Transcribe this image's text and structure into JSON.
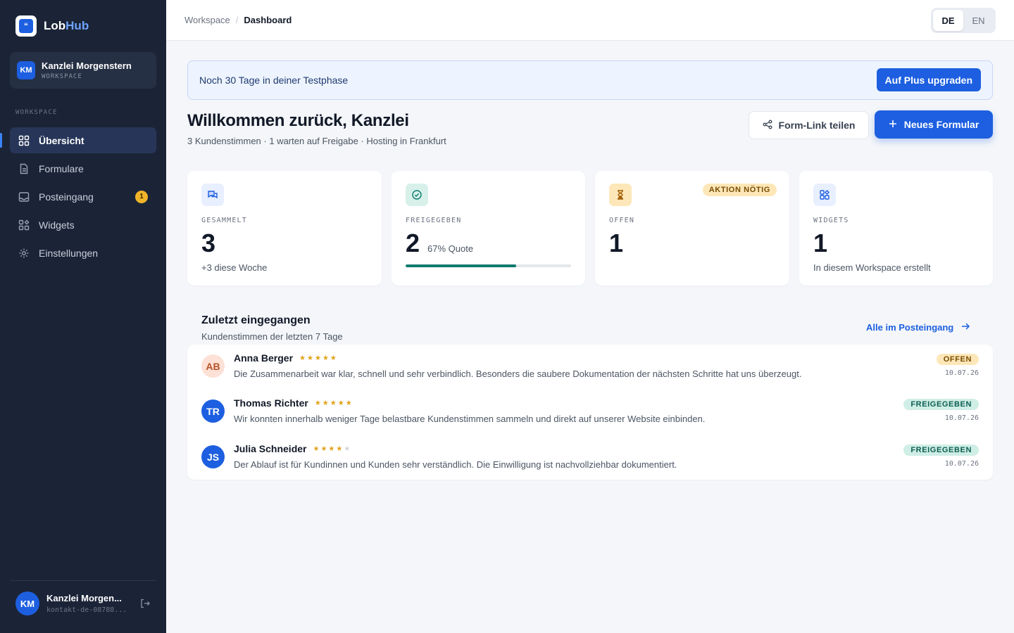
{
  "brand": {
    "name_part1": "Lob",
    "name_part2": "Hub",
    "logo_glyph": "“"
  },
  "workspace": {
    "initials": "KM",
    "name": "Kanzlei Morgenstern",
    "label": "WORKSPACE"
  },
  "sidebar": {
    "section_label": "WORKSPACE",
    "items": [
      {
        "label": "Übersicht",
        "icon": "grid-icon",
        "active": true
      },
      {
        "label": "Formulare",
        "icon": "document-icon"
      },
      {
        "label": "Posteingang",
        "icon": "inbox-icon",
        "badge": "1"
      },
      {
        "label": "Widgets",
        "icon": "widgets-icon"
      },
      {
        "label": "Einstellungen",
        "icon": "gear-icon"
      }
    ]
  },
  "user": {
    "initials": "KM",
    "name": "Kanzlei Morgen...",
    "email": "kontakt-de-08788..."
  },
  "topbar": {
    "breadcrumb": {
      "root": "Workspace",
      "separator": "/",
      "current": "Dashboard"
    },
    "languages": [
      "DE",
      "EN"
    ],
    "active_language": "DE"
  },
  "trial": {
    "text": "Noch 30 Tage in deiner Testphase",
    "button": "Auf Plus upgraden"
  },
  "header": {
    "title": "Willkommen zurück, Kanzlei",
    "subtitle": "3 Kundenstimmen · 1 warten auf Freigabe · Hosting in Frankfurt",
    "share_button": "Form-Link teilen",
    "new_button": "Neues Formular"
  },
  "stats": [
    {
      "label": "GESAMMELT",
      "value": "3",
      "note": "+3 diese Woche",
      "icon": "chat-icon",
      "color": "#1d5fe0",
      "bg": "#e8efff"
    },
    {
      "label": "FREIGEGEBEN",
      "value": "2",
      "quote": "67% Quote",
      "progress": 0.67,
      "icon": "check-circle-icon",
      "color": "#0f7a6e",
      "bg": "#d7f0ea"
    },
    {
      "label": "OFFEN",
      "value": "1",
      "badge": "AKTION NÖTIG",
      "icon": "hourglass-icon",
      "color": "#a15c00",
      "bg": "#fde7b8"
    },
    {
      "label": "WIDGETS",
      "value": "1",
      "note": "In diesem Workspace erstellt",
      "icon": "widgets-icon",
      "color": "#1d5fe0",
      "bg": "#e8efff"
    }
  ],
  "recent": {
    "title": "Zuletzt eingegangen",
    "subtitle": "Kundenstimmen der letzten 7 Tage",
    "link": "Alle im Posteingang",
    "items": [
      {
        "initials": "AB",
        "name": "Anna Berger",
        "rating": 5,
        "text": "Die Zusammenarbeit war klar, schnell und sehr verbindlich. Besonders die saubere Dokumentation der nächsten Schritte hat uns überzeugt.",
        "status": "OFFEN",
        "date": "10.07.26",
        "avatar_bg": "#fde0d6",
        "avatar_fg": "#b4532a"
      },
      {
        "initials": "TR",
        "name": "Thomas Richter",
        "rating": 5,
        "text": "Wir konnten innerhalb weniger Tage belastbare Kundenstimmen sammeln und direkt auf unserer Website einbinden.",
        "status": "FREIGEGEBEN",
        "date": "10.07.26",
        "avatar_bg": "#1d5fe0",
        "avatar_fg": "#ffffff"
      },
      {
        "initials": "JS",
        "name": "Julia Schneider",
        "rating": 4,
        "text": "Der Ablauf ist für Kundinnen und Kunden sehr verständlich. Die Einwilligung ist nachvollziehbar dokumentiert.",
        "status": "FREIGEGEBEN",
        "date": "10.07.26",
        "avatar_bg": "#1d5fe0",
        "avatar_fg": "#ffffff"
      }
    ]
  }
}
